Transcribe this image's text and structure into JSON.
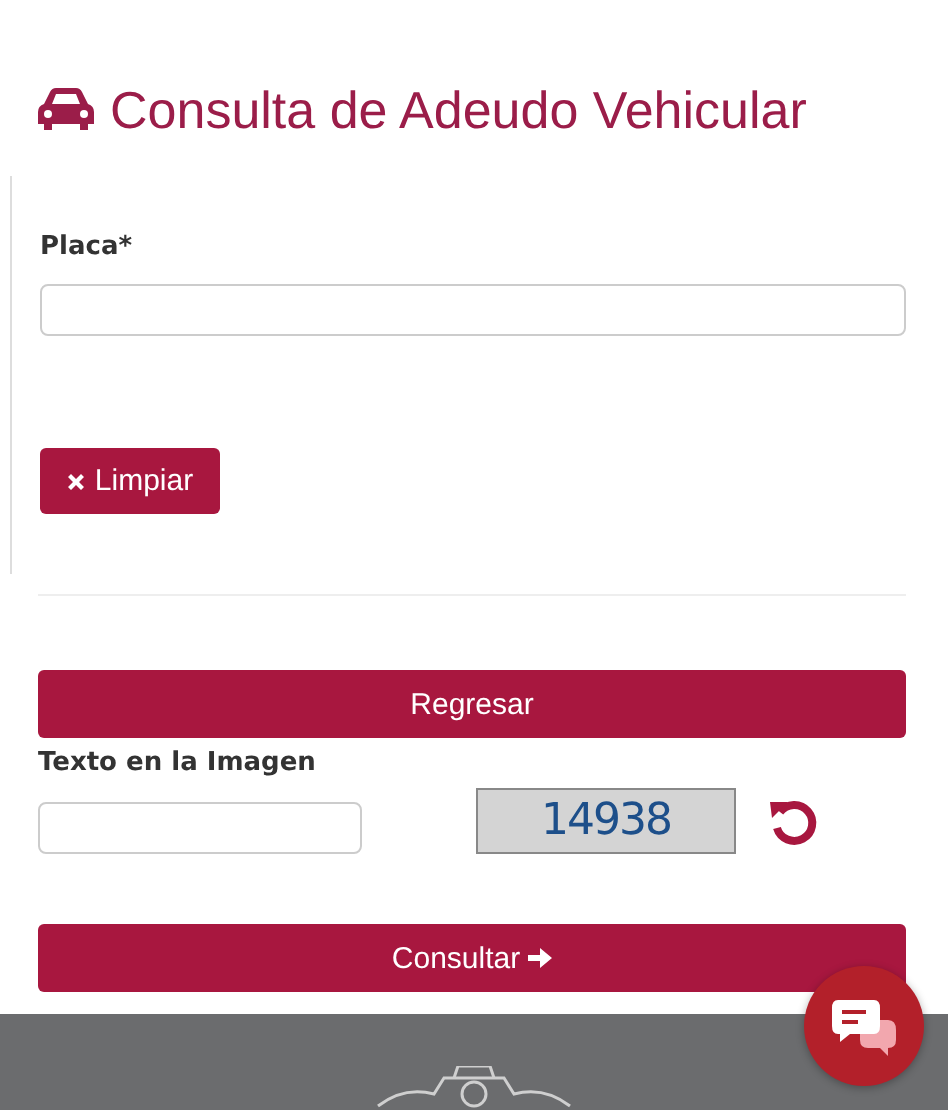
{
  "title": "Consulta de Adeudo Vehicular",
  "form": {
    "plate_label": "Placa*",
    "clear_button": "Limpiar"
  },
  "back_button": "Regresar",
  "captcha": {
    "label": "Texto en la Imagen",
    "code": "14938"
  },
  "submit_button": "Consultar"
}
